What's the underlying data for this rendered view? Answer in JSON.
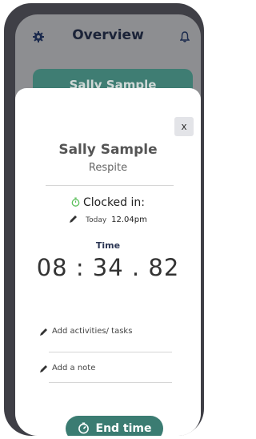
{
  "header": {
    "title": "Overview",
    "left_icon": "gear-icon",
    "right_icon": "bell-icon"
  },
  "background_card": {
    "label": "Sally Sample"
  },
  "modal": {
    "close_label": "x",
    "person_name": "Sally Sample",
    "role": "Respite",
    "status_label": "Clocked in:",
    "status_icon": "timer-icon",
    "day": "Today",
    "clock_in_time": "12.04pm",
    "timer_label": "Time",
    "timer_value": "08 : 34 . 82",
    "actions": {
      "activities": "Add activities/ tasks",
      "note": "Add a note"
    },
    "end_button": "End time"
  },
  "colors": {
    "accent": "#3b7c72",
    "clock_icon": "#5cc05c",
    "dim_overlay": "#8d8e91"
  }
}
